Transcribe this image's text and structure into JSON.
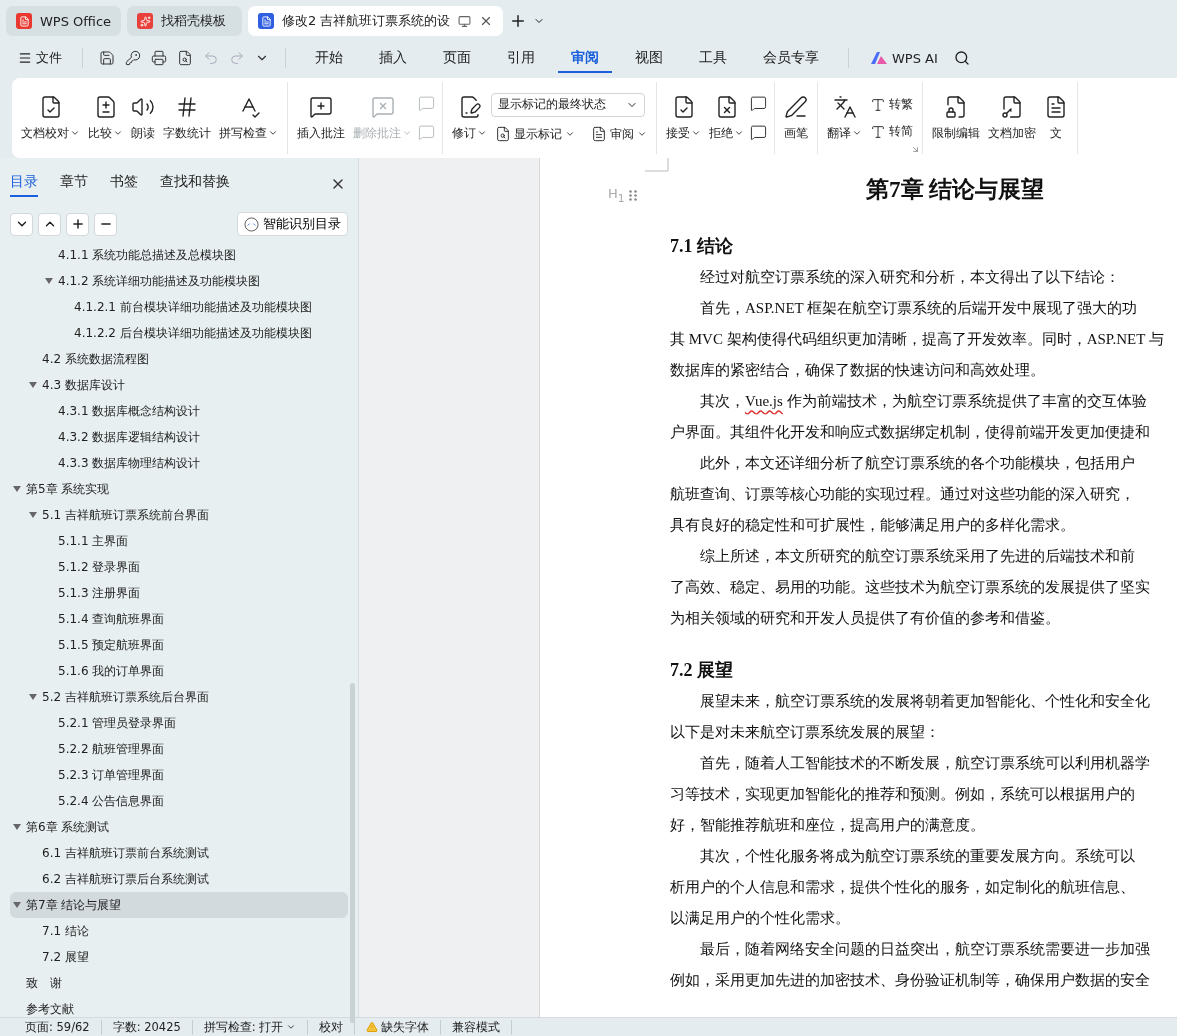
{
  "browser_tabs": [
    {
      "kind": "wps",
      "label": "WPS Office",
      "selected": false,
      "closable": false
    },
    {
      "kind": "template",
      "label": "找稻壳模板",
      "selected": false,
      "closable": false
    },
    {
      "kind": "document",
      "label": "修改2 吉祥航班订票系统的设",
      "selected": true,
      "closable": true
    }
  ],
  "menu": {
    "file": "文件",
    "tabs": [
      {
        "label": "开始",
        "selected": false
      },
      {
        "label": "插入",
        "selected": false
      },
      {
        "label": "页面",
        "selected": false
      },
      {
        "label": "引用",
        "selected": false
      },
      {
        "label": "审阅",
        "selected": true
      },
      {
        "label": "视图",
        "selected": false
      },
      {
        "label": "工具",
        "selected": false
      },
      {
        "label": "会员专享",
        "selected": false
      }
    ],
    "ai": "WPS AI"
  },
  "ribbon": [
    {
      "launcher": false,
      "items": [
        {
          "kind": "large",
          "label": "文档校对",
          "dropdown": true,
          "disabled": false
        },
        {
          "kind": "large",
          "label": "比较",
          "dropdown": true,
          "disabled": false
        },
        {
          "kind": "large",
          "label": "朗读",
          "dropdown": false,
          "disabled": false
        },
        {
          "kind": "large",
          "label": "字数统计",
          "dropdown": false,
          "disabled": false
        },
        {
          "kind": "large",
          "label": "拼写检查",
          "dropdown": true,
          "disabled": false
        }
      ]
    },
    {
      "launcher": false,
      "items": [
        {
          "kind": "large",
          "label": "插入批注",
          "dropdown": false,
          "disabled": false
        },
        {
          "kind": "large",
          "label": "删除批注",
          "dropdown": true,
          "disabled": true
        },
        {
          "kind": "stack",
          "items": [
            {
              "kind": "small",
              "disabled": true
            },
            {
              "kind": "small",
              "disabled": true
            }
          ]
        }
      ]
    },
    {
      "launcher": false,
      "items": [
        {
          "kind": "large",
          "label": "修订",
          "dropdown": true,
          "disabled": false
        },
        {
          "kind": "stack",
          "items": [
            {
              "kind": "select",
              "value": "显示标记的最终状态"
            },
            {
              "kind": "row",
              "items": [
                {
                  "kind": "labeled",
                  "label": "显示标记",
                  "dropdown": true,
                  "disabled": false
                },
                {
                  "kind": "labeled",
                  "label": "审阅",
                  "dropdown": true,
                  "disabled": false
                }
              ]
            }
          ]
        }
      ]
    },
    {
      "launcher": false,
      "items": [
        {
          "kind": "large",
          "label": "接受",
          "dropdown": true,
          "disabled": false
        },
        {
          "kind": "large",
          "label": "拒绝",
          "dropdown": true,
          "disabled": false
        },
        {
          "kind": "stack",
          "items": [
            {
              "kind": "small",
              "disabled": false
            },
            {
              "kind": "small",
              "disabled": false
            }
          ]
        }
      ]
    },
    {
      "launcher": false,
      "items": [
        {
          "kind": "large",
          "label": "画笔",
          "dropdown": false,
          "disabled": false
        }
      ]
    },
    {
      "launcher": true,
      "items": [
        {
          "kind": "large",
          "label": "翻译",
          "dropdown": true,
          "disabled": false
        },
        {
          "kind": "stack",
          "items": [
            {
              "kind": "labeled",
              "label": "转繁",
              "dropdown": false,
              "disabled": false
            },
            {
              "kind": "labeled",
              "label": "转简",
              "dropdown": false,
              "disabled": false
            }
          ]
        }
      ]
    },
    {
      "launcher": false,
      "items": [
        {
          "kind": "large",
          "label": "限制编辑",
          "dropdown": false,
          "disabled": false
        },
        {
          "kind": "large",
          "label": "文档加密",
          "dropdown": false,
          "disabled": false
        },
        {
          "kind": "large",
          "label": "文",
          "dropdown": false,
          "disabled": false
        }
      ]
    }
  ],
  "sidebar": {
    "tabs": [
      {
        "label": "目录",
        "selected": true
      },
      {
        "label": "章节",
        "selected": false
      },
      {
        "label": "书签",
        "selected": false
      },
      {
        "label": "查找和替换",
        "selected": false
      }
    ],
    "smart_button": "智能识别目录",
    "toc": [
      {
        "kind": "continued",
        "children": [
          {
            "kind": "continued",
            "children": [
              {
                "kind": "entry",
                "label": "4.1.1  系统功能总描述及总模块图",
                "selected": false
              },
              {
                "kind": "entry",
                "label": "4.1.2  系统详细功能描述及功能模块图",
                "selected": false,
                "expanded": true,
                "children": [
                  {
                    "kind": "entry",
                    "label": "4.1.2.1  前台模块详细功能描述及功能模块图",
                    "selected": false
                  },
                  {
                    "kind": "entry",
                    "label": "4.1.2.2  后台模块详细功能描述及功能模块图",
                    "selected": false
                  }
                ]
              }
            ]
          },
          {
            "kind": "entry",
            "label": "4.2  系统数据流程图",
            "selected": false
          },
          {
            "kind": "entry",
            "label": "4.3  数据库设计",
            "selected": false,
            "expanded": true,
            "children": [
              {
                "kind": "entry",
                "label": "4.3.1 数据库概念结构设计",
                "selected": false
              },
              {
                "kind": "entry",
                "label": "4.3.2  数据库逻辑结构设计",
                "selected": false
              },
              {
                "kind": "entry",
                "label": "4.3.3  数据库物理结构设计",
                "selected": false
              }
            ]
          }
        ]
      },
      {
        "kind": "entry",
        "label": "第5章  系统实现",
        "selected": false,
        "expanded": true,
        "children": [
          {
            "kind": "entry",
            "label": "5.1  吉祥航班订票系统前台界面",
            "selected": false,
            "expanded": true,
            "children": [
              {
                "kind": "entry",
                "label": "5.1.1  主界面",
                "selected": false
              },
              {
                "kind": "entry",
                "label": "5.1.2  登录界面",
                "selected": false
              },
              {
                "kind": "entry",
                "label": "5.1.3  注册界面",
                "selected": false
              },
              {
                "kind": "entry",
                "label": "5.1.4  查询航班界面",
                "selected": false
              },
              {
                "kind": "entry",
                "label": "5.1.5  预定航班界面",
                "selected": false
              },
              {
                "kind": "entry",
                "label": "5.1.6  我的订单界面",
                "selected": false
              }
            ]
          },
          {
            "kind": "entry",
            "label": "5.2  吉祥航班订票系统后台界面",
            "selected": false,
            "expanded": true,
            "children": [
              {
                "kind": "entry",
                "label": "5.2.1  管理员登录界面",
                "selected": false
              },
              {
                "kind": "entry",
                "label": "5.2.2  航班管理界面",
                "selected": false
              },
              {
                "kind": "entry",
                "label": "5.2.3  订单管理界面",
                "selected": false
              },
              {
                "kind": "entry",
                "label": "5.2.4 公告信息界面",
                "selected": false
              }
            ]
          }
        ]
      },
      {
        "kind": "entry",
        "label": "第6章  系统测试",
        "selected": false,
        "expanded": true,
        "children": [
          {
            "kind": "entry",
            "label": "6.1  吉祥航班订票前台系统测试",
            "selected": false
          },
          {
            "kind": "entry",
            "label": "6.2  吉祥航班订票后台系统测试",
            "selected": false
          }
        ]
      },
      {
        "kind": "entry",
        "label": "第7章  结论与展望",
        "selected": true,
        "expanded": true,
        "children": [
          {
            "kind": "entry",
            "label": "7.1  结论",
            "selected": false
          },
          {
            "kind": "entry",
            "label": "7.2  展望",
            "selected": false
          }
        ]
      },
      {
        "kind": "entry",
        "label": "致　谢",
        "selected": false
      },
      {
        "kind": "entry",
        "label": "参考文献",
        "selected": false
      }
    ]
  },
  "document": {
    "heading_marker": "H$_{1}$",
    "chapter_title": "第7章  结论与展望",
    "sections": [
      {
        "heading": "7.1  结论",
        "paragraphs": [
          {
            "lines": [
              "经过对航空订票系统的深入研究和分析，本文得出了以下结论："
            ]
          },
          {
            "lines": [
              "首先，ASP.NET 框架在航空订票系统的后端开发中展现了强大的功",
              "其 MVC 架构使得代码组织更加清晰，提高了开发效率。同时，ASP.NET 与",
              "数据库的紧密结合，确保了数据的快速访问和高效处理。"
            ]
          },
          {
            "lines": [
              [
                {
                  "text": "其次，",
                  "misspelled": false
                },
                {
                  "text": "Vue.js",
                  "misspelled": true
                },
                {
                  "text": " 作为前端技术，为航空订票系统提供了丰富的交互体验",
                  "misspelled": false
                }
              ],
              "户界面。其组件化开发和响应式数据绑定机制，使得前端开发更加便捷和"
            ]
          },
          {
            "lines": [
              "此外，本文还详细分析了航空订票系统的各个功能模块，包括用户",
              "航班查询、订票等核心功能的实现过程。通过对这些功能的深入研究，",
              "具有良好的稳定性和可扩展性，能够满足用户的多样化需求。"
            ]
          },
          {
            "lines": [
              "综上所述，本文所研究的航空订票系统采用了先进的后端技术和前",
              "了高效、稳定、易用的功能。这些技术为航空订票系统的发展提供了坚实",
              "为相关领域的研究和开发人员提供了有价值的参考和借鉴。"
            ]
          }
        ]
      },
      {
        "heading": "7.2  展望",
        "paragraphs": [
          {
            "lines": [
              "展望未来，航空订票系统的发展将朝着更加智能化、个性化和安全化",
              "以下是对未来航空订票系统发展的展望："
            ]
          },
          {
            "lines": [
              "首先，随着人工智能技术的不断发展，航空订票系统可以利用机器学",
              "习等技术，实现更加智能化的推荐和预测。例如，系统可以根据用户的",
              "好，智能推荐航班和座位，提高用户的满意度。"
            ]
          },
          {
            "lines": [
              "其次，个性化服务将成为航空订票系统的重要发展方向。系统可以",
              "析用户的个人信息和需求，提供个性化的服务，如定制化的航班信息、",
              "以满足用户的个性化需求。"
            ]
          },
          {
            "lines": [
              "最后，随着网络安全问题的日益突出，航空订票系统需要进一步加强",
              "例如，采用更加先进的加密技术、身份验证机制等，确保用户数据的安全"
            ]
          }
        ]
      }
    ]
  },
  "status_bar": [
    {
      "kind": "text",
      "label": "页面: 59/62"
    },
    {
      "kind": "text",
      "label": "字数: 20425"
    },
    {
      "kind": "dropdown",
      "label": "拼写检查: 打开"
    },
    {
      "kind": "text",
      "label": "校对"
    },
    {
      "kind": "warning",
      "label": "缺失字体"
    },
    {
      "kind": "text",
      "label": "兼容模式"
    }
  ]
}
